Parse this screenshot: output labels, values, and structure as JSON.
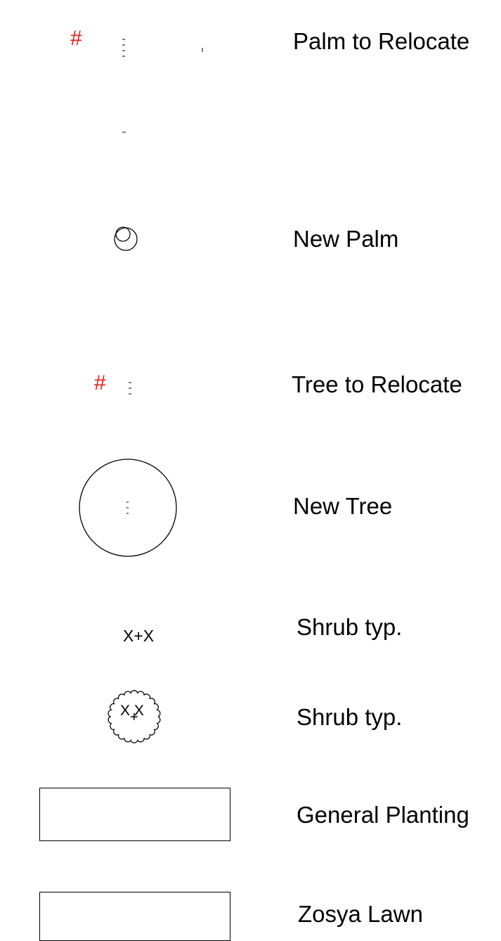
{
  "legend": {
    "colors": {
      "line": "#000000",
      "relocate_mark": "#e02020"
    },
    "items": [
      {
        "id": "palm-relocate",
        "symbol": "relocate-mark-icon",
        "mark": "#",
        "label": "Palm to Relocate"
      },
      {
        "id": "new-palm",
        "symbol": "palm-icon",
        "label": "New Palm"
      },
      {
        "id": "tree-relocate",
        "symbol": "relocate-mark-icon",
        "mark": "#",
        "label": "Tree to Relocate"
      },
      {
        "id": "new-tree",
        "symbol": "tree-icon",
        "label": "New Tree"
      },
      {
        "id": "shrub-a",
        "symbol": "shrub-icon",
        "mark": "X+X",
        "label": "Shrub typ."
      },
      {
        "id": "shrub-b",
        "symbol": "shrub-cloud-icon",
        "mark": "X X",
        "label": "Shrub typ."
      },
      {
        "id": "general-planting",
        "symbol": "planting-area-icon",
        "label": "General Planting"
      },
      {
        "id": "zosya-lawn",
        "symbol": "lawn-area-icon",
        "label": "Zosya Lawn"
      }
    ]
  }
}
